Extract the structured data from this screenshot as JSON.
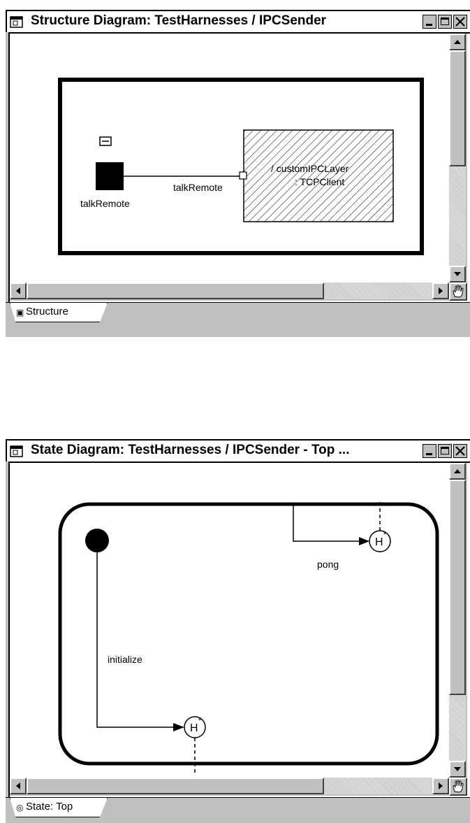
{
  "structure_window": {
    "title": "Structure Diagram: TestHarnesses / IPCSender",
    "tab_label": "Structure",
    "port_label": "talkRemote",
    "connector_label": "talkRemote",
    "capsule_role": "/ customIPCLayer",
    "capsule_class": ": TCPClient"
  },
  "state_window": {
    "title": "State Diagram: TestHarnesses / IPCSender - Top ...",
    "tab_label": "State: Top",
    "transition_initialize": "initialize",
    "transition_pong": "pong",
    "history_symbol": "H"
  },
  "icons": [
    "window-icon",
    "minimize-icon",
    "maximize-icon",
    "close-icon",
    "hand-icon",
    "scroll-up-icon",
    "scroll-down-icon",
    "scroll-left-icon",
    "scroll-right-icon"
  ]
}
